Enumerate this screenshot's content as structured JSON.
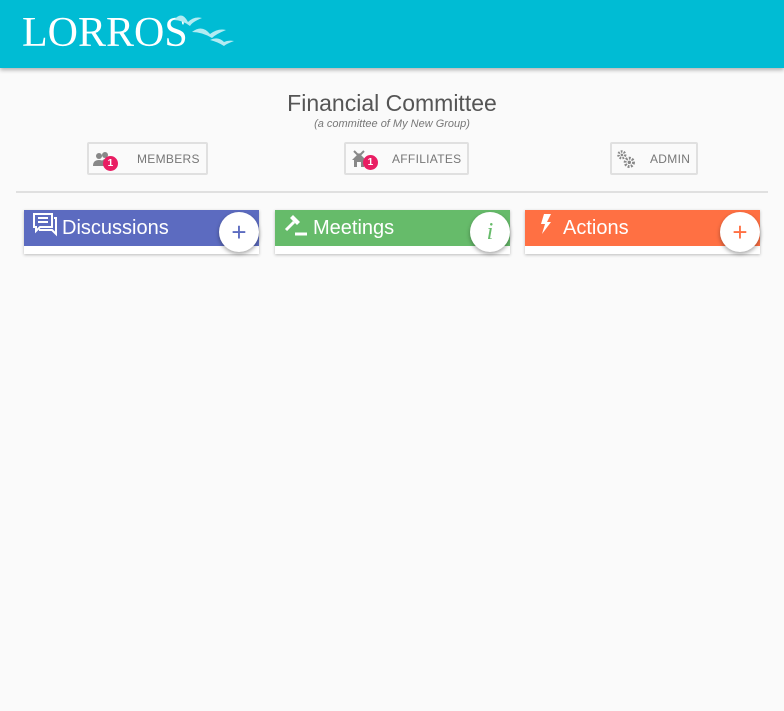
{
  "app": {
    "logo_text": "LORROS"
  },
  "page": {
    "title": "Financial Committee",
    "subtitle": "(a committee of My New Group)"
  },
  "nav": {
    "members": {
      "label": "MEMBERS",
      "badge": "1"
    },
    "affiliates": {
      "label": "AFFILIATES",
      "badge": "1"
    },
    "admin": {
      "label": "ADMIN"
    }
  },
  "cards": {
    "discussions": {
      "label": "Discussions",
      "action": "+",
      "color": "#5c6bc0",
      "icon": "chat-icon"
    },
    "meetings": {
      "label": "Meetings",
      "action": "i",
      "color": "#66bb6a",
      "icon": "gavel-icon"
    },
    "actions": {
      "label": "Actions",
      "action": "+",
      "color": "#ff7043",
      "icon": "lightning-icon"
    }
  },
  "colors": {
    "topbar": "#00bcd4",
    "badge": "#e91e63",
    "background": "#fafafa"
  }
}
